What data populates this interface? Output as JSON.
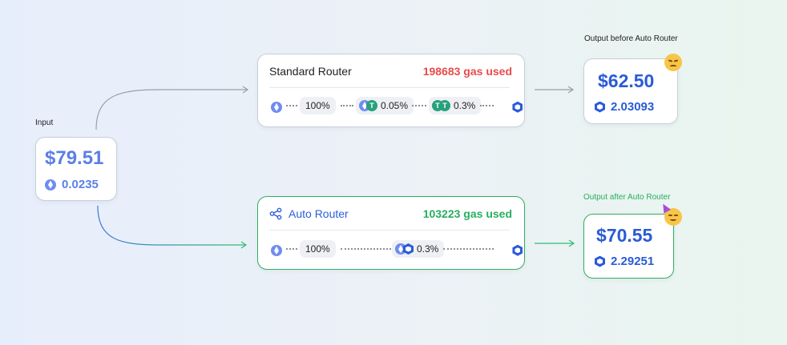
{
  "input": {
    "label": "Input",
    "usd": "$79.51",
    "amount": "0.0235",
    "token_icon": "eth-icon"
  },
  "standard_router": {
    "title": "Standard Router",
    "gas": "198683 gas used",
    "route": [
      {
        "type": "token",
        "icon": "eth-icon"
      },
      {
        "type": "pill",
        "text": "100%"
      },
      {
        "type": "pill",
        "icon": "eth-usdt-pair-icon",
        "text": "0.05%"
      },
      {
        "type": "pill",
        "icon": "usdt-usdt-pair-icon",
        "text": "0.3%"
      },
      {
        "type": "token",
        "icon": "hex-token-icon"
      }
    ]
  },
  "auto_router": {
    "title": "Auto Router",
    "title_icon": "share-nodes-icon",
    "gas": "103223 gas used",
    "route": [
      {
        "type": "token",
        "icon": "eth-icon"
      },
      {
        "type": "pill",
        "text": "100%"
      },
      {
        "type": "pill",
        "icon": "eth-hex-pair-icon",
        "text": "0.3%"
      },
      {
        "type": "token",
        "icon": "hex-token-icon"
      }
    ]
  },
  "output_before": {
    "label": "Output before Auto Router",
    "usd": "$62.50",
    "amount": "2.03093",
    "emoji": "pensive-face-icon"
  },
  "output_after": {
    "label": "Output after Auto Router",
    "usd": "$70.55",
    "amount": "2.29251",
    "emoji": "partying-face-icon"
  },
  "colors": {
    "primary_blue": "#2a5bd7",
    "gas_red": "#e94b4b",
    "gas_green": "#27ae60",
    "connector_gray": "#9aa0a8"
  }
}
